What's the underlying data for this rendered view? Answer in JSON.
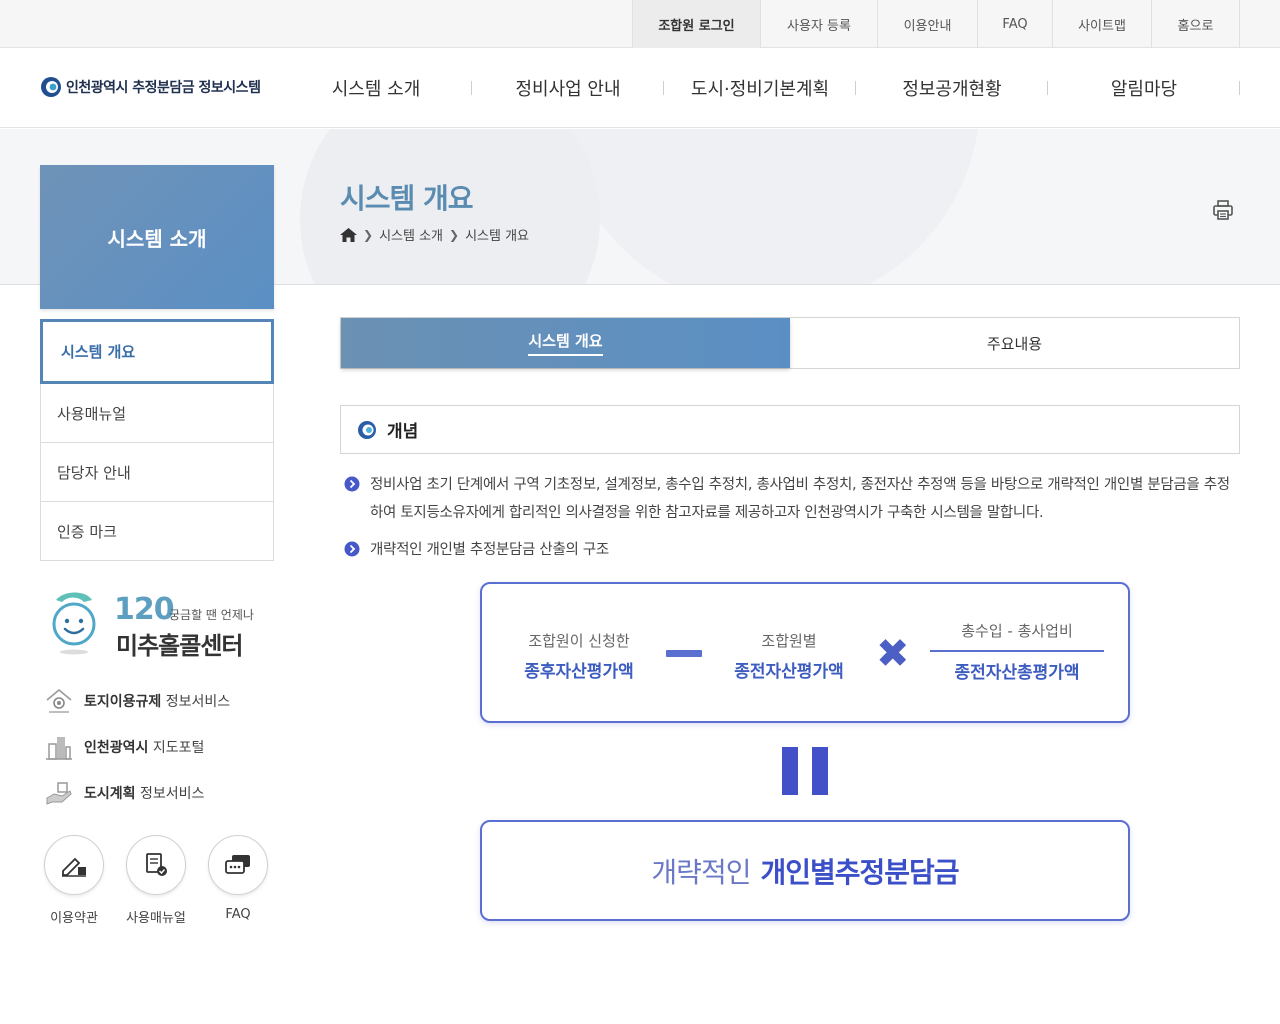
{
  "topbar": {
    "links": [
      {
        "label": "조합원 로그인",
        "active": true
      },
      {
        "label": "사용자 등록",
        "active": false
      },
      {
        "label": "이용안내",
        "active": false
      },
      {
        "label": "FAQ",
        "active": false
      },
      {
        "label": "사이트맵",
        "active": false
      },
      {
        "label": "홈으로",
        "active": false
      }
    ]
  },
  "header": {
    "logo_text": "인천광역시 추정분담금 정보시스템",
    "nav": [
      "시스템 소개",
      "정비사업 안내",
      "도시·정비기본계획",
      "정보공개현황",
      "알림마당"
    ]
  },
  "visual": {
    "page_title": "시스템 개요",
    "breadcrumb": [
      "시스템 소개",
      "시스템 개요"
    ]
  },
  "sidebar": {
    "title": "시스템 소개",
    "items": [
      {
        "label": "시스템 개요",
        "active": true
      },
      {
        "label": "사용매뉴얼",
        "active": false
      },
      {
        "label": "담당자 안내",
        "active": false
      },
      {
        "label": "인증 마크",
        "active": false
      }
    ],
    "callcenter": {
      "number": "120",
      "sub": "궁금할 땐 언제나",
      "name": "미추홀콜센터"
    },
    "services": [
      {
        "bold": "토지이용규제",
        "rest": " 정보서비스",
        "icon": "land-icon"
      },
      {
        "bold": "인천광역시",
        "rest": " 지도포털",
        "icon": "building-icon"
      },
      {
        "bold": "도시계획",
        "rest": " 정보서비스",
        "icon": "hand-icon"
      }
    ],
    "quick": [
      {
        "label": "이용약관",
        "icon": "pen-icon"
      },
      {
        "label": "사용매뉴얼",
        "icon": "document-check-icon"
      },
      {
        "label": "FAQ",
        "icon": "chat-icon"
      }
    ]
  },
  "content": {
    "tabs": [
      "시스템 개요",
      "주요내용"
    ],
    "section_title": "개념",
    "bullet1": "정비사업 초기 단계에서 구역 기초정보, 설계정보, 총수입 추정치, 총사업비 추정치, 종전자산 추정액 등을 바탕으로 개략적인 개인별 분담금을 추정하여 토지등소유자에게 합리적인 의사결정을 위한 참고자료를 제공하고자 인천광역시가 구축한 시스템을 말합니다.",
    "bullet2": "개략적인 개인별 추정분담금 산출의 구조",
    "diagram": {
      "term1_small": "조합원이 신청한",
      "term1_big": "종후자산평가액",
      "term2_small": "조합원별",
      "term2_big": "종전자산평가액",
      "numerator": "총수입 - 총사업비",
      "denominator": "종전자산총평가액",
      "result_light": "개략적인",
      "result_bold": "개인별추정분담금"
    }
  },
  "colors": {
    "accent": "#5b8fc4",
    "diagram_blue": "#4351c8",
    "title_blue": "#5a8bb0"
  }
}
